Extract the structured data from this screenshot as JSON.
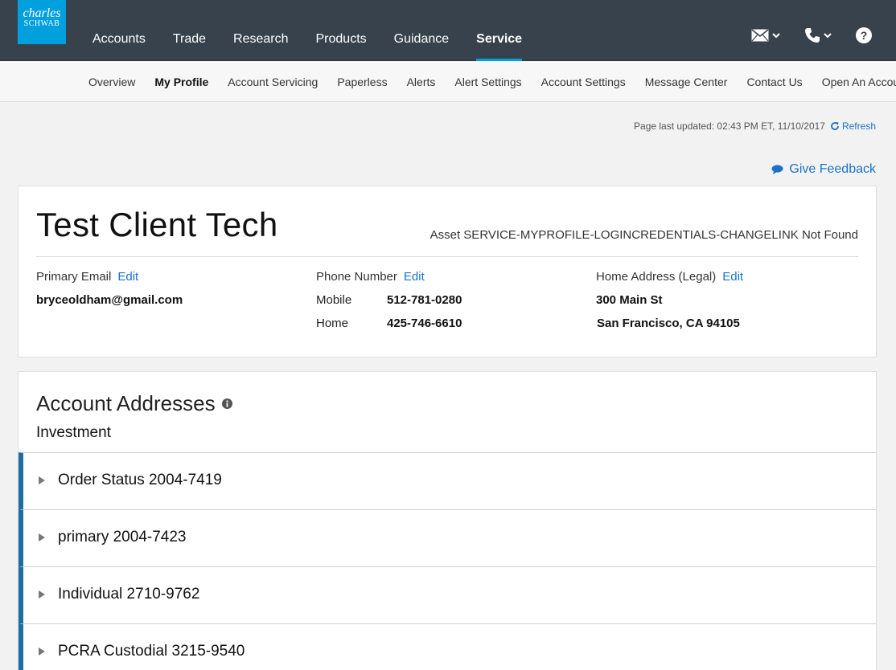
{
  "brand": {
    "line1": "charles",
    "line2": "SCHWAB"
  },
  "main_nav": [
    {
      "label": "Accounts"
    },
    {
      "label": "Trade"
    },
    {
      "label": "Research"
    },
    {
      "label": "Products"
    },
    {
      "label": "Guidance"
    },
    {
      "label": "Service",
      "active": true
    }
  ],
  "utility_icons": [
    "mail-icon",
    "phone-icon",
    "help-icon"
  ],
  "sub_nav": [
    {
      "label": "Overview"
    },
    {
      "label": "My Profile",
      "active": true
    },
    {
      "label": "Account Servicing"
    },
    {
      "label": "Paperless"
    },
    {
      "label": "Alerts"
    },
    {
      "label": "Alert Settings"
    },
    {
      "label": "Account Settings"
    },
    {
      "label": "Message Center"
    },
    {
      "label": "Contact Us"
    },
    {
      "label": "Open An Account"
    }
  ],
  "page_updated": {
    "text": "Page last updated: 02:43 PM ET, 11/10/2017",
    "refresh_label": "Refresh"
  },
  "feedback_label": "Give Feedback",
  "profile": {
    "name": "Test Client Tech",
    "asset_notice": "Asset SERVICE-MYPROFILE-LOGINCREDENTIALS-CHANGELINK Not Found",
    "email": {
      "label": "Primary Email",
      "edit": "Edit",
      "value": "bryceoldham@gmail.com"
    },
    "phone": {
      "label": "Phone Number",
      "edit": "Edit",
      "rows": [
        {
          "type": "Mobile",
          "number": "512-781-0280"
        },
        {
          "type": "Home",
          "number": "425-746-6610"
        }
      ]
    },
    "address": {
      "label": "Home Address (Legal)",
      "edit": "Edit",
      "line1": "300 Main St",
      "line2": "San Francisco, CA 94105"
    }
  },
  "addresses": {
    "title": "Account Addresses",
    "group": "Investment",
    "accounts": [
      {
        "name": "Order Status 2004-7419"
      },
      {
        "name": "primary 2004-7423"
      },
      {
        "name": "Individual 2710-9762"
      },
      {
        "name": "PCRA Custodial 3215-9540"
      }
    ]
  },
  "colors": {
    "nav_bg": "#37424d",
    "brand_blue": "#00a0df",
    "link": "#1a73c8",
    "account_bar": "#1f6ea3"
  }
}
